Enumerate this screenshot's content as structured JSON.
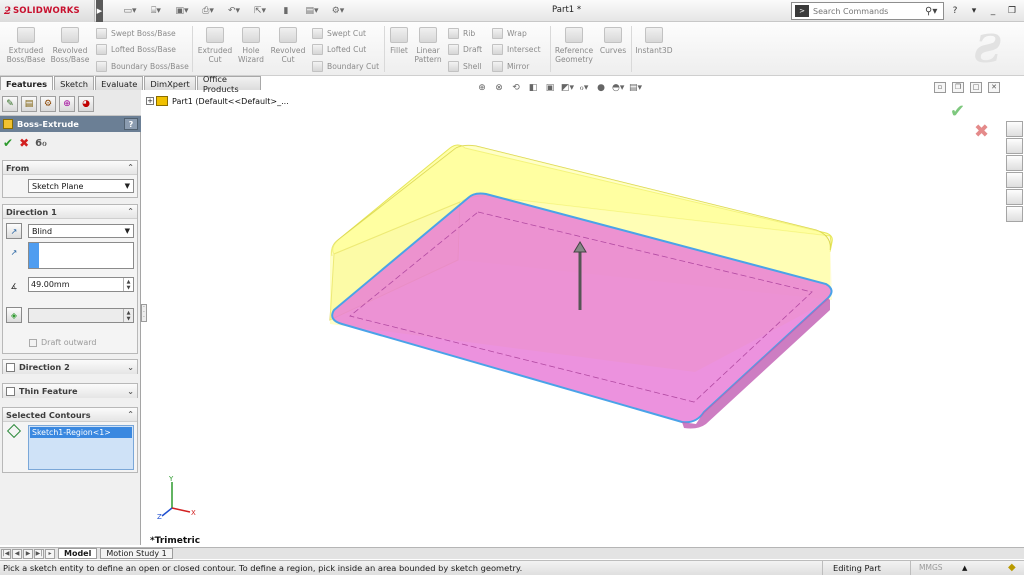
{
  "app": {
    "brand_prefix": "ƻ",
    "brand": "SOLIDWORKS",
    "doc_title": "Part1 *"
  },
  "titlebar": {
    "search_placeholder": "Search Commands",
    "help_label": "?",
    "min": "_",
    "restore": "❐",
    "close": "✕"
  },
  "ribbon": {
    "extruded_boss": "Extruded Boss/Base",
    "revolved_boss": "Revolved Boss/Base",
    "swept_boss": "Swept Boss/Base",
    "lofted_boss": "Lofted Boss/Base",
    "boundary_boss": "Boundary Boss/Base",
    "extruded_cut": "Extruded Cut",
    "hole_wizard": "Hole Wizard",
    "revolved_cut": "Revolved Cut",
    "swept_cut": "Swept Cut",
    "lofted_cut": "Lofted Cut",
    "boundary_cut": "Boundary Cut",
    "fillet": "Fillet",
    "linear_pattern": "Linear Pattern",
    "rib": "Rib",
    "draft": "Draft",
    "shell": "Shell",
    "wrap": "Wrap",
    "intersect": "Intersect",
    "mirror": "Mirror",
    "reference_geometry": "Reference Geometry",
    "curves": "Curves",
    "instant3d": "Instant3D"
  },
  "tabs": [
    "Features",
    "Sketch",
    "Evaluate",
    "DimXpert",
    "Office Products"
  ],
  "property_manager": {
    "title": "Boss-Extrude",
    "help": "?",
    "from": {
      "header": "From",
      "value": "Sketch Plane"
    },
    "direction1": {
      "header": "Direction 1",
      "end_condition": "Blind",
      "depth": "49.00mm",
      "draft_label": "Draft outward"
    },
    "direction2": {
      "header": "Direction 2"
    },
    "thin_feature": {
      "header": "Thin Feature"
    },
    "selected_contours": {
      "header": "Selected Contours",
      "item": "Sketch1-Region<1>"
    }
  },
  "tree": {
    "part_label": "Part1  (Default<<Default>_..."
  },
  "viewport": {
    "view_name": "*Trimetric",
    "axis_x": "X",
    "axis_y": "Y",
    "axis_z": "Z"
  },
  "bottom_tabs": [
    "Model",
    "Motion Study 1"
  ],
  "status": {
    "message": "Pick a sketch entity to define an open or closed contour. To define a region, pick inside an area bounded by sketch geometry.",
    "mode": "Editing Part",
    "units": "MMGS"
  },
  "colors": {
    "preview_top": "#ffff9a",
    "preview_face": "#e87ad7",
    "edge_blue": "#4aa3e8",
    "pm_title_bg": "#6b7f95"
  }
}
